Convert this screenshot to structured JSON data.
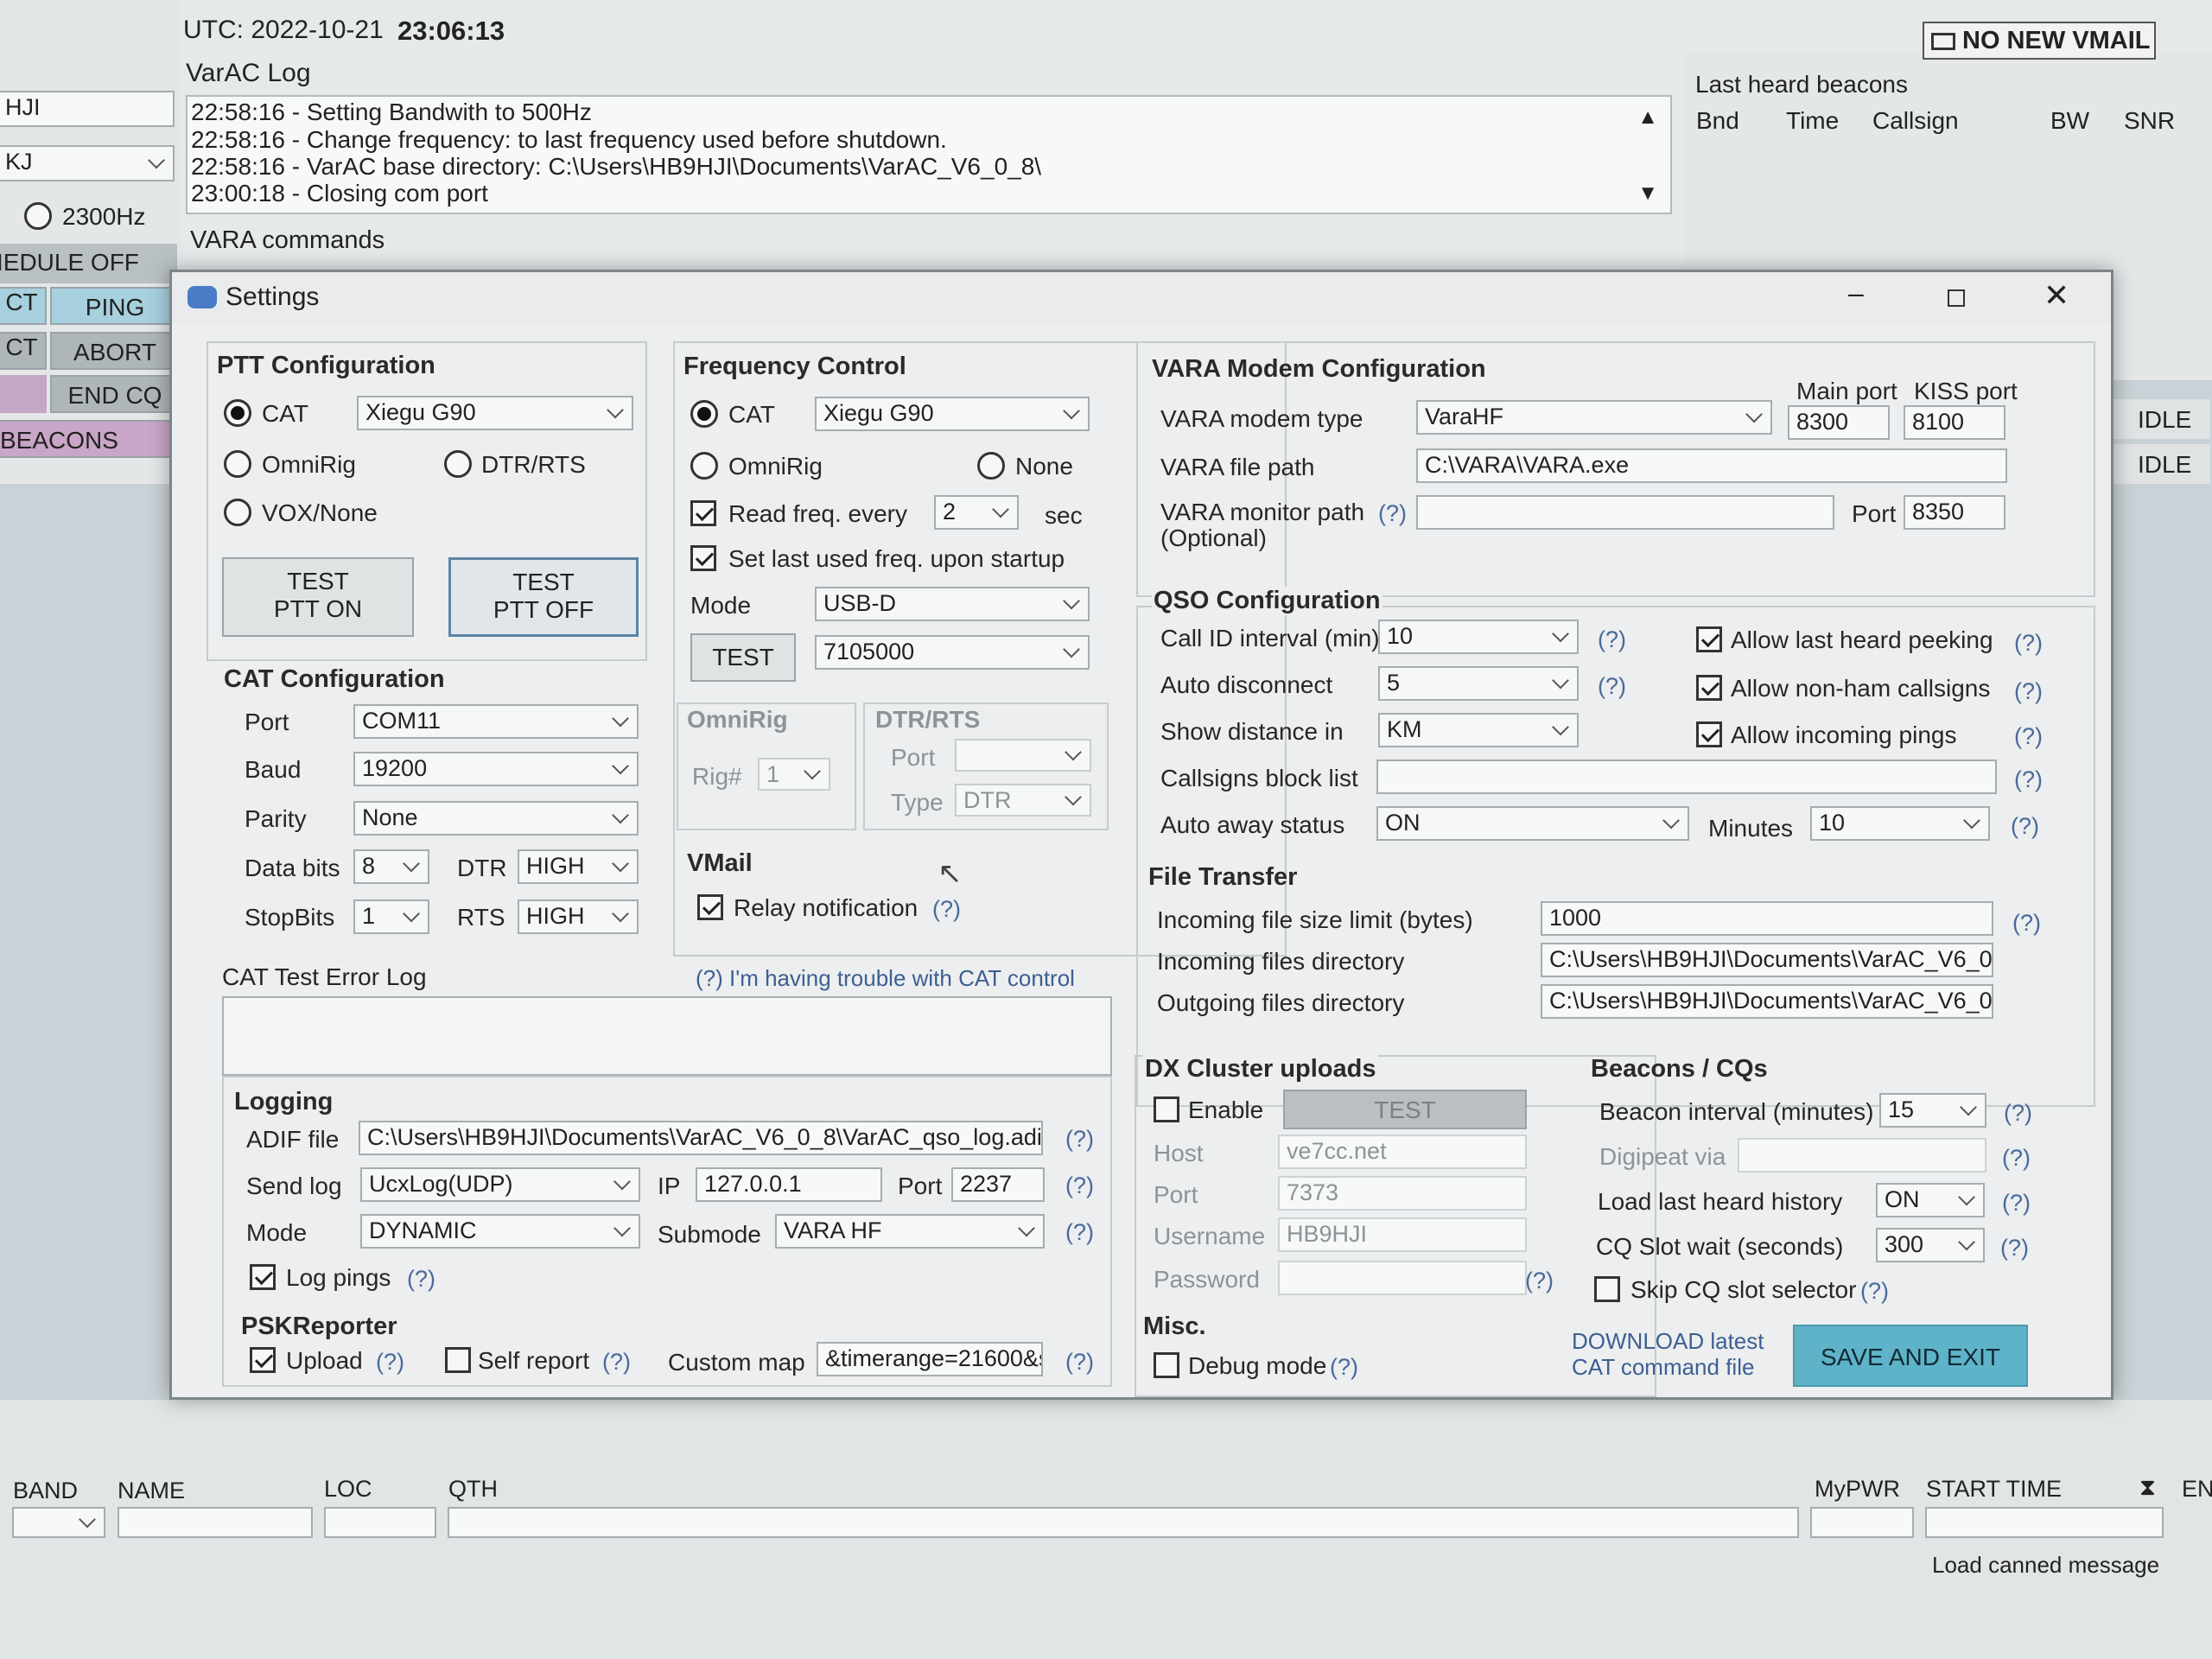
{
  "header": {
    "utc_label": "UTC: 2022-10-21",
    "utc_time": "23:06:13",
    "vmail_badge": "NO NEW VMAIL",
    "log_title": "VarAC Log",
    "log_lines": [
      "22:58:16 - Setting Bandwith to 500Hz",
      "22:58:16 - Change frequency: to last frequency used before shutdown.",
      "22:58:16 - VarAC base directory: C:\\Users\\HB9HJI\\Documents\\VarAC_V6_0_8\\",
      "23:00:18 - Closing com port"
    ],
    "vara_commands": "VARA commands"
  },
  "left_panel": {
    "callsign": "HJI",
    "grid": "KJ",
    "bw": "2300Hz",
    "schedule": "IEDULE OFF",
    "btn_ct": "CT",
    "btn_ping": "PING",
    "btn_ct2": "CT",
    "btn_abort": "ABORT",
    "btn_endcq": "END CQ",
    "beacons": "BEACONS"
  },
  "beacons_panel": {
    "title": "Last heard beacons",
    "cols": [
      "Bnd",
      "Time",
      "Callsign",
      "BW",
      "SNR"
    ],
    "status1": "IDLE",
    "status2": "IDLE"
  },
  "bottom": {
    "cols": [
      "BAND",
      "NAME",
      "LOC",
      "QTH",
      "MyPWR",
      "START TIME",
      "EN"
    ],
    "canned": "Load canned message"
  },
  "dialog": {
    "title": "Settings",
    "ptt": {
      "title": "PTT Configuration",
      "cat": "CAT",
      "cat_value": "Xiegu G90",
      "omnirig": "OmniRig",
      "dtr_rts": "DTR/RTS",
      "vox": "VOX/None",
      "test_on": [
        "TEST",
        "PTT ON"
      ],
      "test_off": [
        "TEST",
        "PTT OFF"
      ]
    },
    "cat_config": {
      "title": "CAT Configuration",
      "port_label": "Port",
      "port": "COM11",
      "baud_label": "Baud",
      "baud": "19200",
      "parity_label": "Parity",
      "parity": "None",
      "databits_label": "Data bits",
      "databits": "8",
      "dtr_label": "DTR",
      "dtr": "HIGH",
      "stopbits_label": "StopBits",
      "stopbits": "1",
      "rts_label": "RTS",
      "rts": "HIGH",
      "error_log": "CAT Test Error Log",
      "trouble_link": "(?) I'm having trouble with CAT control"
    },
    "freq": {
      "title": "Frequency Control",
      "cat": "CAT",
      "cat_value": "Xiegu G90",
      "omnirig": "OmniRig",
      "none": "None",
      "read_freq": "Read freq. every",
      "read_value": "2",
      "sec": "sec",
      "set_last": "Set last used freq. upon startup",
      "mode_label": "Mode",
      "mode": "USB-D",
      "test": "TEST",
      "freq_value": "7105000",
      "omnirig_title": "OmniRig",
      "rig_label": "Rig#",
      "rig_value": "1",
      "dtr_title": "DTR/RTS",
      "port_label": "Port",
      "type_label": "Type",
      "type_value": "DTR"
    },
    "vmail": {
      "title": "VMail",
      "relay": "Relay notification"
    },
    "vara": {
      "title": "VARA Modem Configuration",
      "main_port_label": "Main port",
      "kiss_port_label": "KISS port",
      "type_label": "VARA modem type",
      "type": "VaraHF",
      "main_port": "8300",
      "kiss_port": "8100",
      "path_label": "VARA file path",
      "path": "C:\\VARA\\VARA.exe",
      "monitor_label": "VARA monitor path",
      "monitor_opt": "(Optional)",
      "port_label": "Port",
      "monitor_port": "8350"
    },
    "qso": {
      "title": "QSO Configuration",
      "callid_label": "Call ID interval (min)",
      "callid": "10",
      "autodisc_label": "Auto disconnect",
      "autodisc": "5",
      "distance_label": "Show distance in",
      "distance": "KM",
      "block_label": "Callsigns block list",
      "away_label": "Auto away status",
      "away": "ON",
      "minutes_label": "Minutes",
      "minutes": "10",
      "peek": "Allow last heard peeking",
      "nonham": "Allow non-ham callsigns",
      "pings": "Allow incoming pings"
    },
    "file": {
      "title": "File Transfer",
      "limit_label": "Incoming file size limit (bytes)",
      "limit": "1000",
      "in_label": "Incoming files directory",
      "in_dir": "C:\\Users\\HB9HJI\\Documents\\VarAC_V6_0",
      "out_label": "Outgoing files directory",
      "out_dir": "C:\\Users\\HB9HJI\\Documents\\VarAC_V6_0"
    },
    "logging": {
      "title": "Logging",
      "adif_label": "ADIF file",
      "adif": "C:\\Users\\HB9HJI\\Documents\\VarAC_V6_0_8\\VarAC_qso_log.adi",
      "send_label": "Send log",
      "send": "UcxLog(UDP)",
      "ip_label": "IP",
      "ip": "127.0.0.1",
      "port_label": "Port",
      "port": "2237",
      "mode_label": "Mode",
      "mode": "DYNAMIC",
      "submode_label": "Submode",
      "submode": "VARA HF",
      "log_pings": "Log pings"
    },
    "psk": {
      "title": "PSKReporter",
      "upload": "Upload",
      "self_report": "Self report",
      "custom_label": "Custom map",
      "custom": "&timerange=21600&sl"
    },
    "dx": {
      "title": "DX Cluster uploads",
      "enable": "Enable",
      "test": "TEST",
      "host_label": "Host",
      "host": "ve7cc.net",
      "port_label": "Port",
      "port": "7373",
      "user_label": "Username",
      "user": "HB9HJI",
      "pass_label": "Password"
    },
    "beacons": {
      "title": "Beacons / CQs",
      "interval_label": "Beacon interval (minutes)",
      "interval": "15",
      "digi_label": "Digipeat via",
      "history_label": "Load last heard history",
      "history": "ON",
      "cqwait_label": "CQ Slot wait (seconds)",
      "cqwait": "300",
      "skip": "Skip CQ slot selector"
    },
    "misc": {
      "title": "Misc.",
      "debug": "Debug mode",
      "download": [
        "DOWNLOAD latest",
        "CAT command file"
      ],
      "save": "SAVE AND EXIT"
    },
    "help": "(?)"
  },
  "icons": [
    "mail-icon",
    "chevron-up-icon",
    "chevron-down-icon",
    "settings-chat-icon",
    "minimize-icon",
    "maximize-icon",
    "close-icon",
    "hourglass-icon",
    "mouse-cursor-icon"
  ]
}
